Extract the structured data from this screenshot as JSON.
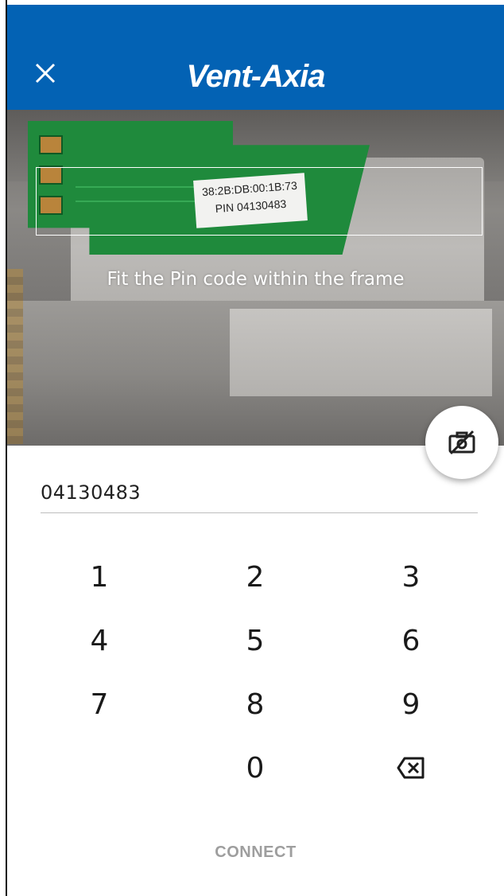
{
  "header": {
    "logo_text": "Vent-Axia",
    "close_icon": "close-icon",
    "background": "#0362b4"
  },
  "camera": {
    "device_label_line1": "38:2B:DB:00:1B:73",
    "device_label_line2": "PIN 04130483",
    "hint": "Fit the Pin code within the frame",
    "toggle_icon": "camera-off-icon"
  },
  "pin": {
    "value": "04130483"
  },
  "keypad": {
    "keys": [
      "1",
      "2",
      "3",
      "4",
      "5",
      "6",
      "7",
      "8",
      "9",
      "0"
    ],
    "backspace_icon": "backspace-icon"
  },
  "actions": {
    "connect_label": "CONNECT"
  }
}
